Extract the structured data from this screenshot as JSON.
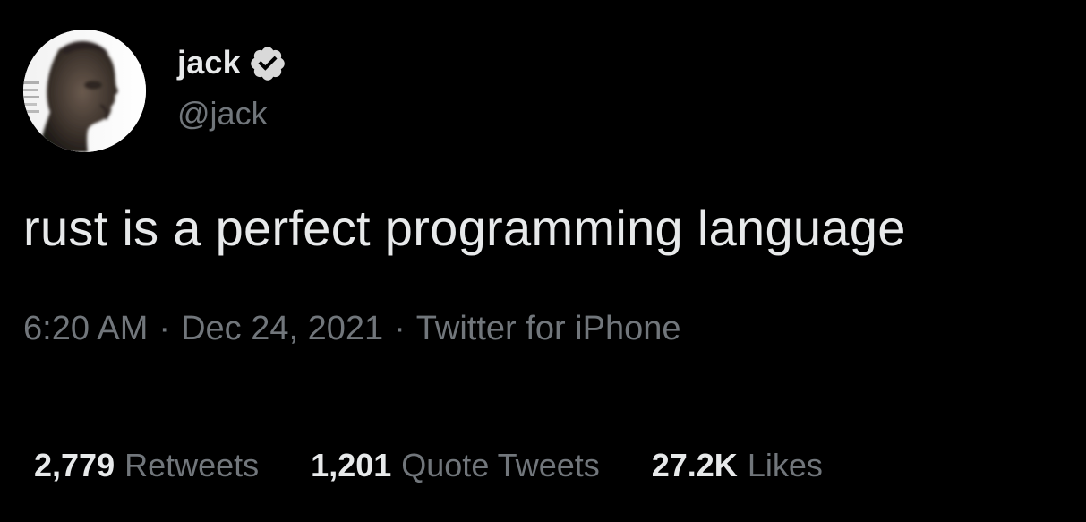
{
  "author": {
    "display_name": "jack",
    "handle": "@jack",
    "verified": true,
    "avatar_icon": "profile-photo"
  },
  "tweet": {
    "text": "rust is a perfect programming language",
    "time": "6:20 AM",
    "date": "Dec 24, 2021",
    "source": "Twitter for iPhone",
    "separator": "·"
  },
  "stats": {
    "retweets": {
      "count": "2,779",
      "label": "Retweets"
    },
    "quote_tweets": {
      "count": "1,201",
      "label": "Quote Tweets"
    },
    "likes": {
      "count": "27.2K",
      "label": "Likes"
    }
  },
  "colors": {
    "background": "#000000",
    "primary_text": "#e7e9ea",
    "secondary_text": "#71767b",
    "divider": "#2f3336"
  }
}
